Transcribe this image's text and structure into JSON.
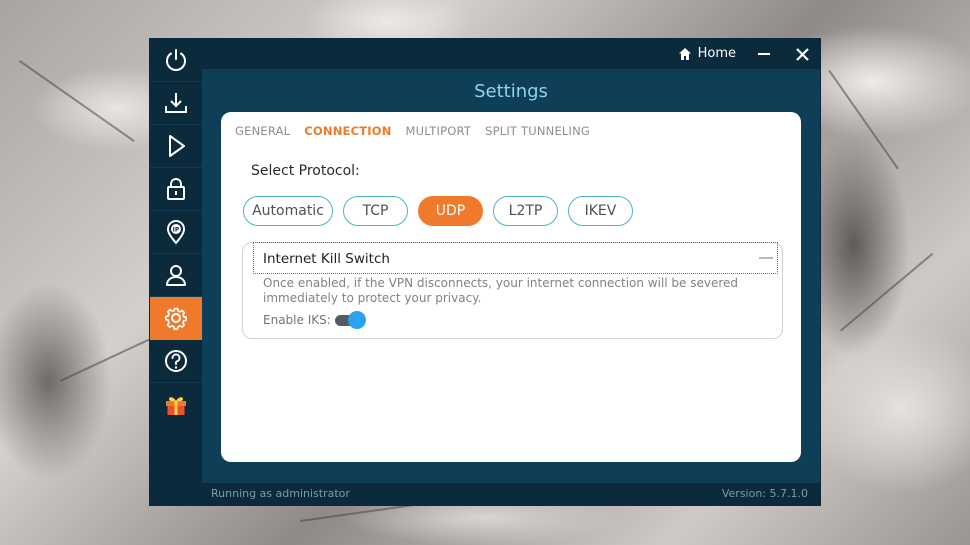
{
  "window": {
    "home_label": "Home",
    "settings_title": "Settings"
  },
  "sidebar": {
    "items": [
      {
        "icon": "power-icon"
      },
      {
        "icon": "download-icon"
      },
      {
        "icon": "play-icon"
      },
      {
        "icon": "lock-icon"
      },
      {
        "icon": "ip-location-icon"
      },
      {
        "icon": "user-icon"
      },
      {
        "icon": "gear-icon",
        "active": true
      },
      {
        "icon": "help-icon"
      },
      {
        "icon": "gift-icon"
      }
    ]
  },
  "tabs": [
    {
      "label": "GENERAL"
    },
    {
      "label": "CONNECTION",
      "active": true
    },
    {
      "label": "MULTIPORT"
    },
    {
      "label": "SPLIT TUNNELING"
    }
  ],
  "protocol": {
    "label": "Select Protocol:",
    "options": [
      "Automatic",
      "TCP",
      "UDP",
      "L2TP",
      "IKEV"
    ],
    "selected": "UDP"
  },
  "kill_switch": {
    "title": "Internet Kill Switch",
    "description": "Once enabled, if the VPN disconnects, your internet connection will be severed immediately to protect your privacy.",
    "enable_label": "Enable IKS:",
    "enabled": true
  },
  "status": {
    "left": "Running as administrator",
    "version": "Version:  5.7.1.0"
  },
  "colors": {
    "accent": "#f07a2b",
    "window_bg": "#0f3e57",
    "sidebar_bg": "#0b2a3c",
    "title_color": "#8fd3ef",
    "pill_border": "#4cb3c8",
    "toggle_on": "#2aa3ef"
  }
}
